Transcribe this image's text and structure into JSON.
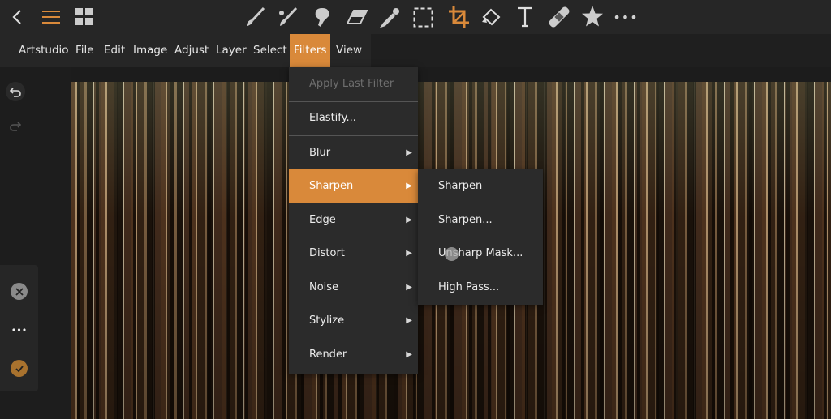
{
  "toolbar": {
    "icons": [
      "back-icon",
      "menu-icon",
      "grid-icon",
      "paintbrush-icon",
      "mixer-brush-icon",
      "smudge-icon",
      "eraser-icon",
      "eyedropper-icon",
      "selection-icon",
      "crop-icon",
      "transform-icon",
      "text-icon",
      "healing-icon",
      "star-icon",
      "more-icon"
    ],
    "accent": "#d9893a"
  },
  "menubar": {
    "items": [
      "Artstudio",
      "File",
      "Edit",
      "Image",
      "Adjust",
      "Layer",
      "Select",
      "Filters",
      "View"
    ],
    "active": "Filters"
  },
  "filters_menu": {
    "items": [
      {
        "label": "Apply Last Filter",
        "disabled": true
      },
      {
        "label": "Elastify..."
      },
      {
        "label": "Blur",
        "submenu": true
      },
      {
        "label": "Sharpen",
        "submenu": true,
        "selected": true
      },
      {
        "label": "Edge",
        "submenu": true
      },
      {
        "label": "Distort",
        "submenu": true
      },
      {
        "label": "Noise",
        "submenu": true
      },
      {
        "label": "Stylize",
        "submenu": true
      },
      {
        "label": "Render",
        "submenu": true
      }
    ],
    "arrow": "▶"
  },
  "sharpen_submenu": {
    "items": [
      "Sharpen",
      "Sharpen...",
      "Unsharp Mask...",
      "High Pass..."
    ]
  },
  "side": {
    "undo": "undo-icon",
    "redo": "redo-icon",
    "cancel": "close-icon",
    "more": "more-icon",
    "apply": "check-icon"
  }
}
